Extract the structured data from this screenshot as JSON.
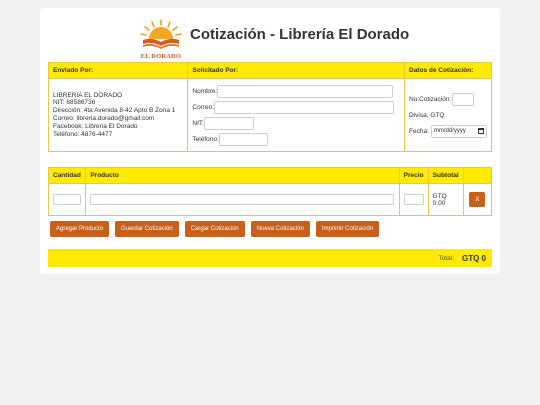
{
  "logo": {
    "text": "EL DORADO"
  },
  "title": "Cotización - Librería El Dorado",
  "quote_table": {
    "headers": [
      "Enviado Por:",
      "Solicitado Por:",
      "Datos de Cotización:"
    ],
    "sender": {
      "name": "LIBRERIA EL DORADO",
      "nit": "NIT: 68586736",
      "address": "Dirección: 4ta Avenida 8-42 Apto B Zona 1",
      "email": "Correo: libreria.dorado@gmail.com",
      "facebook": "Facebook: Libreria El Dorado",
      "phone": "Teléfono: 4876-4477"
    },
    "requester": {
      "nombre_label": "Nombre:",
      "correo_label": "Correo:",
      "nit_label": "NIT:",
      "telefono_label": "Teléfono:",
      "nombre": "",
      "correo": "",
      "nit": "",
      "telefono": ""
    },
    "quote": {
      "no_label": "No.Cotización:",
      "no_value": "",
      "divisa_label": "Divisa:",
      "divisa_value": "GTQ",
      "fecha_label": "Fecha:",
      "fecha_value": "mm/dd/yyyy"
    }
  },
  "products_table": {
    "headers": [
      "Cantidad",
      "Producto",
      "Precio",
      "Subtotal",
      ""
    ],
    "row": {
      "cantidad": "",
      "producto": "",
      "precio": "",
      "subtotal_currency": "GTQ",
      "subtotal_value": "0.00",
      "delete_label": "X"
    }
  },
  "actions": {
    "add": "Agregar Producto",
    "save": "Guardar Cotización",
    "load": "Cargar Cotización",
    "new": "Nueva Cotización",
    "print": "Imprimir Cotización"
  },
  "total": {
    "label": "Total:",
    "value": "GTQ 0"
  },
  "colors": {
    "accent": "#c8601a",
    "yellow": "#ffea00",
    "border": "#e8c64a",
    "background": "#f3f2f2"
  }
}
